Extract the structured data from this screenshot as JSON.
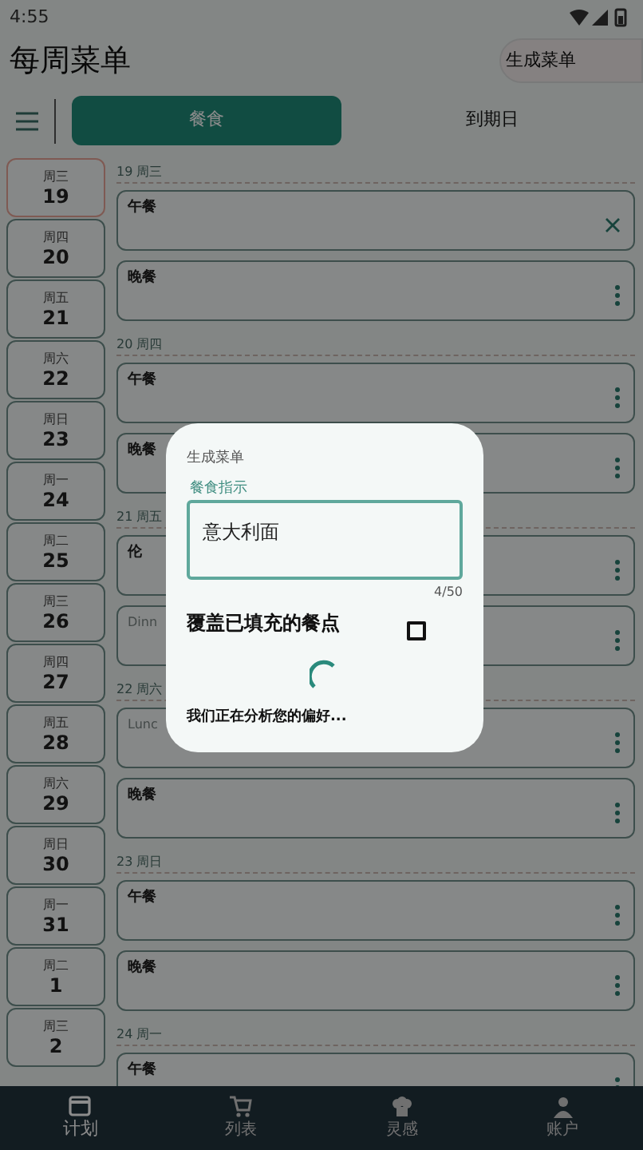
{
  "status_bar": {
    "time": "4:55"
  },
  "header": {
    "title": "每周菜单",
    "generate_button": "生成菜单"
  },
  "tabs": [
    {
      "label": "餐食",
      "selected": true
    },
    {
      "label": "到期日",
      "selected": false
    }
  ],
  "dates": [
    {
      "weekday": "周三",
      "day": "19",
      "selected": true
    },
    {
      "weekday": "周四",
      "day": "20",
      "selected": false
    },
    {
      "weekday": "周五",
      "day": "21",
      "selected": false
    },
    {
      "weekday": "周六",
      "day": "22",
      "selected": false
    },
    {
      "weekday": "周日",
      "day": "23",
      "selected": false
    },
    {
      "weekday": "周一",
      "day": "24",
      "selected": false
    },
    {
      "weekday": "周二",
      "day": "25",
      "selected": false
    },
    {
      "weekday": "周三",
      "day": "26",
      "selected": false
    },
    {
      "weekday": "周四",
      "day": "27",
      "selected": false
    },
    {
      "weekday": "周五",
      "day": "28",
      "selected": false
    },
    {
      "weekday": "周六",
      "day": "29",
      "selected": false
    },
    {
      "weekday": "周日",
      "day": "30",
      "selected": false
    },
    {
      "weekday": "周一",
      "day": "31",
      "selected": false
    },
    {
      "weekday": "周二",
      "day": "1",
      "selected": false
    },
    {
      "weekday": "周三",
      "day": "2",
      "selected": false
    }
  ],
  "days": [
    {
      "heading": "19 周三",
      "meals": [
        {
          "label": "午餐",
          "kind": "clear",
          "hint": false
        },
        {
          "label": "晚餐",
          "kind": "more",
          "hint": false
        }
      ]
    },
    {
      "heading": "20 周四",
      "meals": [
        {
          "label": "午餐",
          "kind": "more",
          "hint": false
        },
        {
          "label": "晚餐",
          "kind": "more",
          "hint": false
        }
      ]
    },
    {
      "heading": "21 周五",
      "meals": [
        {
          "label": "伦",
          "kind": "more",
          "hint": false
        },
        {
          "label": "Dinn",
          "kind": "more",
          "hint": true
        }
      ]
    },
    {
      "heading": "22 周六",
      "meals": [
        {
          "label": "Lunc",
          "kind": "more",
          "hint": true
        },
        {
          "label": "晚餐",
          "kind": "more",
          "hint": false
        }
      ]
    },
    {
      "heading": "23 周日",
      "meals": [
        {
          "label": "午餐",
          "kind": "more",
          "hint": false
        },
        {
          "label": "晚餐",
          "kind": "more",
          "hint": false
        }
      ]
    },
    {
      "heading": "24 周一",
      "meals": [
        {
          "label": "午餐",
          "kind": "more",
          "hint": false
        }
      ]
    }
  ],
  "dialog": {
    "title": "生成菜单",
    "field": {
      "label": "餐食指示",
      "value": "意大利面",
      "counter": "4/50"
    },
    "checkbox": {
      "label": "覆盖已填充的餐点",
      "checked": false
    },
    "loading_text": "我们正在分析您的偏好..."
  },
  "nav": [
    {
      "label": "计划",
      "selected": true
    },
    {
      "label": "列表",
      "selected": false
    },
    {
      "label": "灵感",
      "selected": false
    },
    {
      "label": "账户",
      "selected": false
    }
  ]
}
